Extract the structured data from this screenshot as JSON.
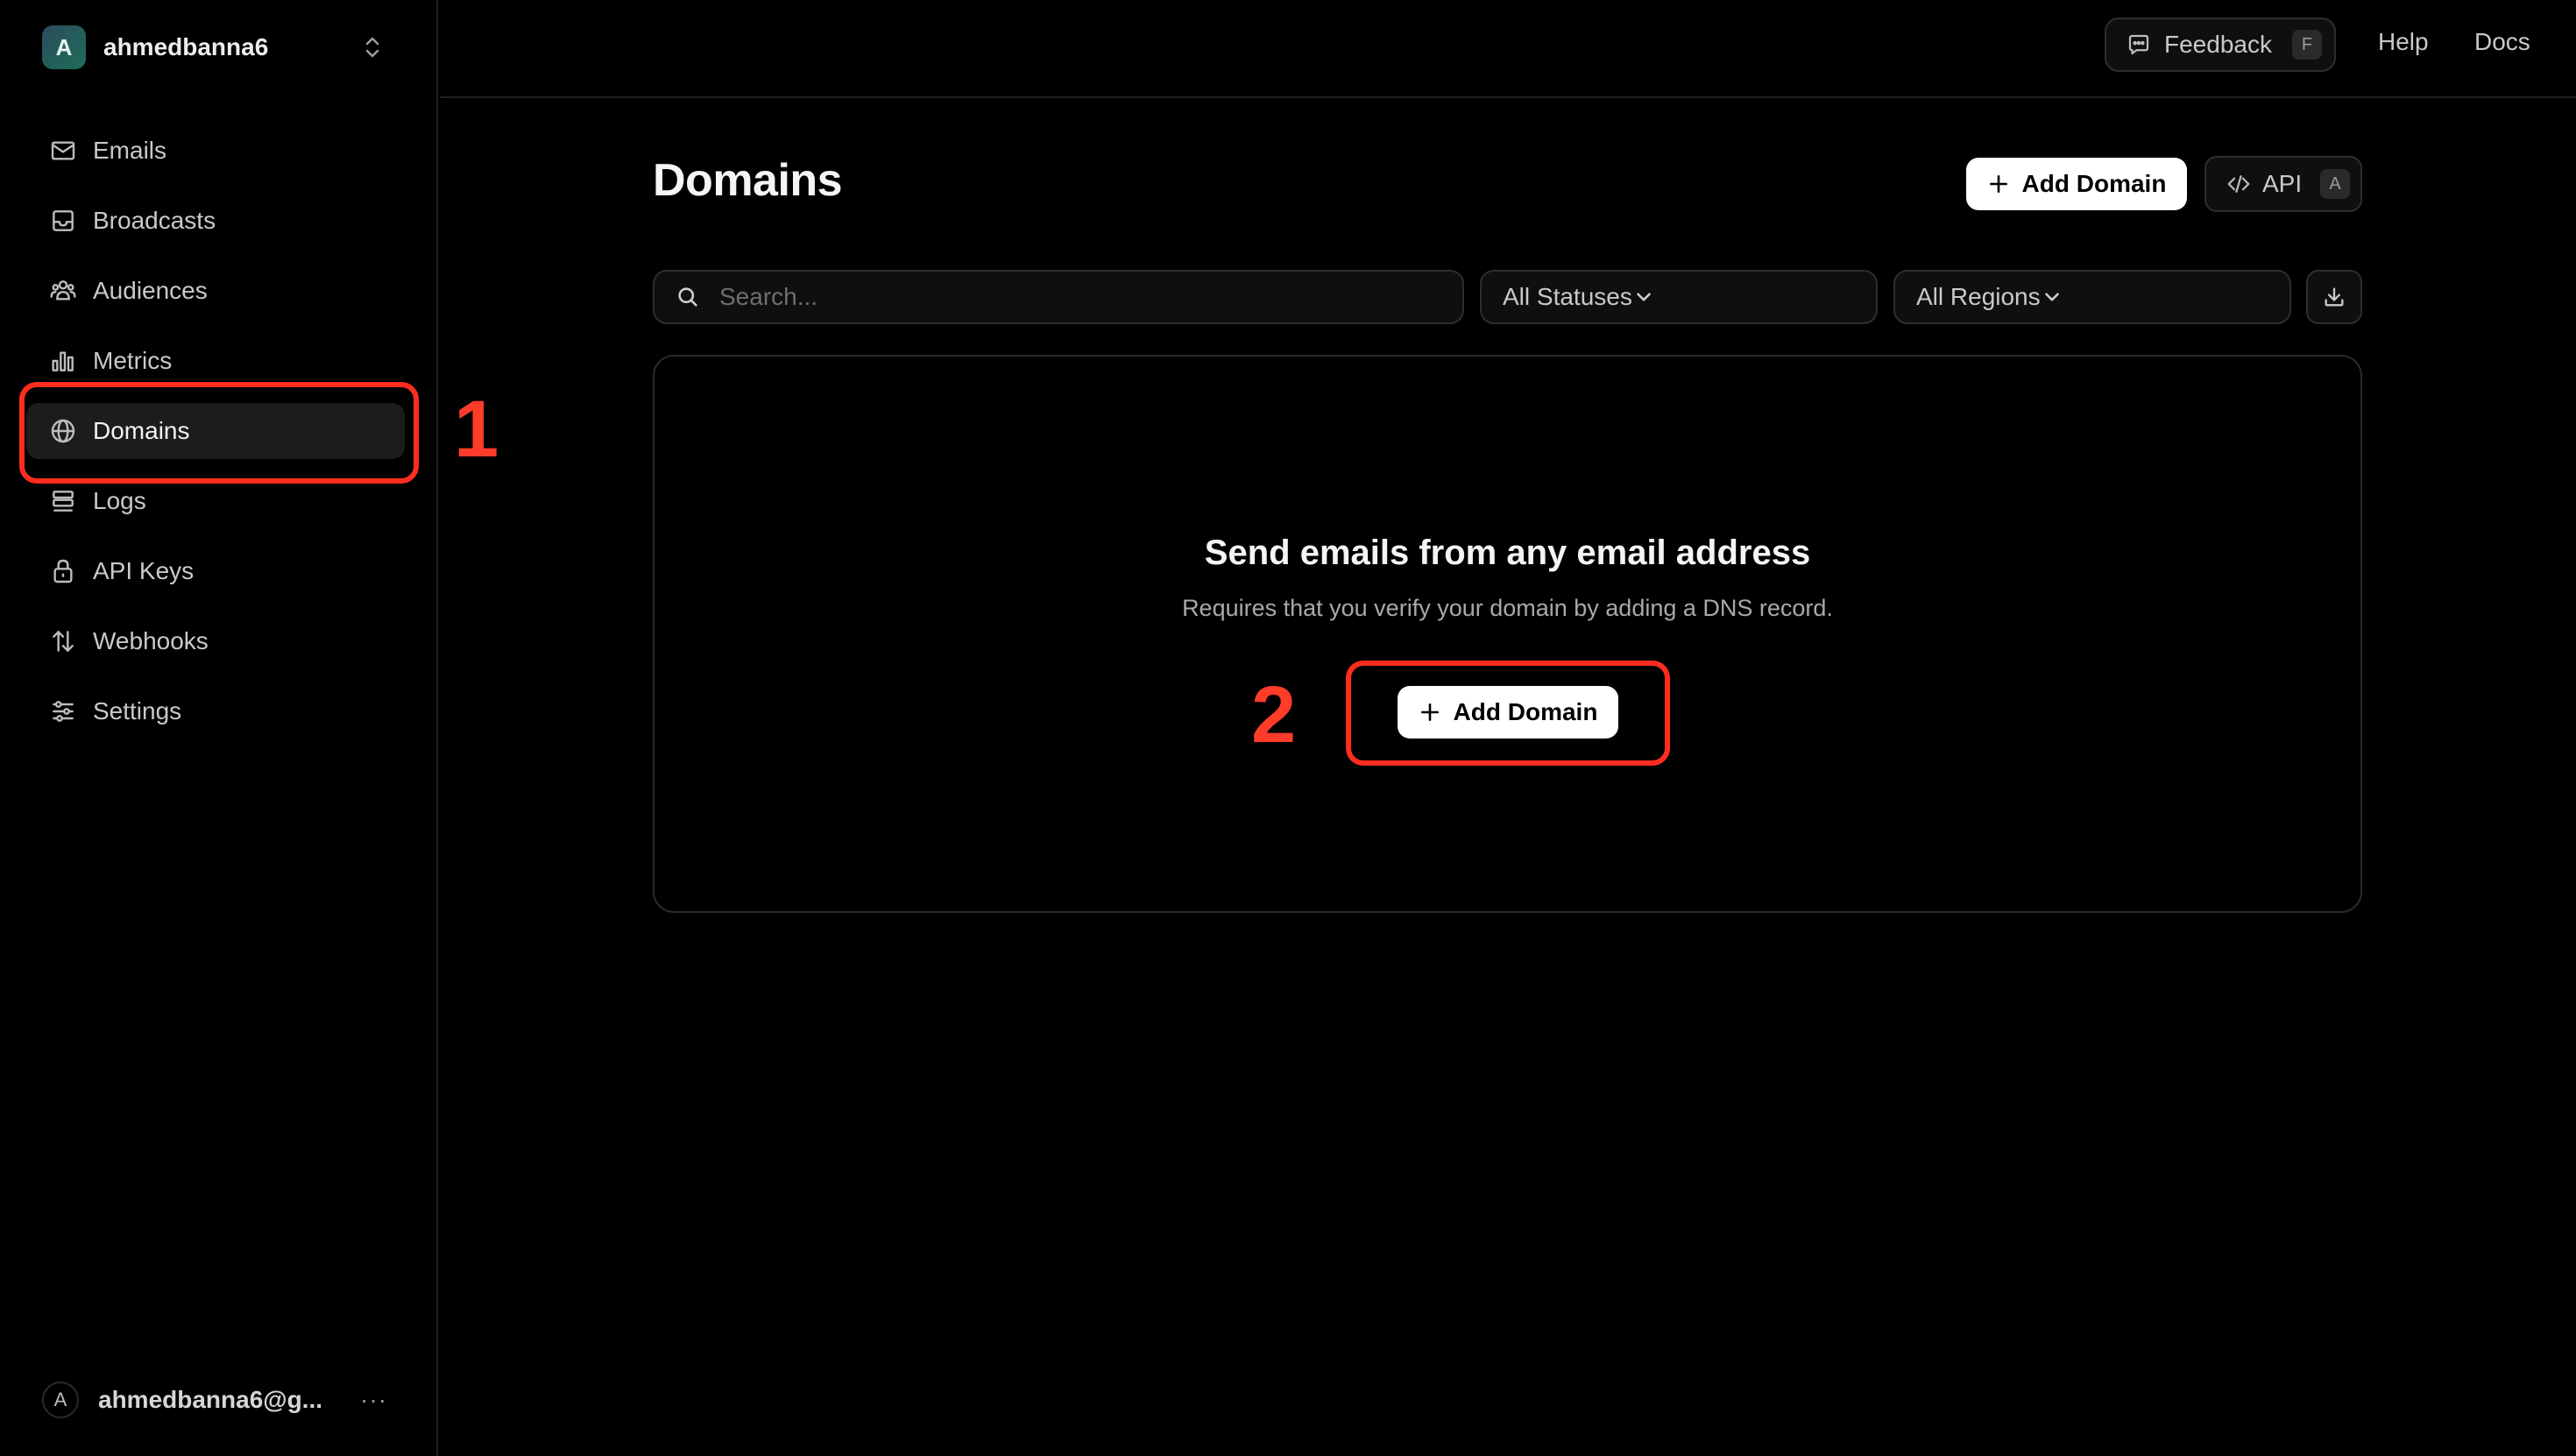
{
  "team": {
    "avatar_letter": "A",
    "name": "ahmedbanna6"
  },
  "sidebar": {
    "items": [
      {
        "label": "Emails",
        "icon": "mail-icon"
      },
      {
        "label": "Broadcasts",
        "icon": "inbox-icon"
      },
      {
        "label": "Audiences",
        "icon": "users-icon"
      },
      {
        "label": "Metrics",
        "icon": "bar-chart-icon"
      },
      {
        "label": "Domains",
        "icon": "globe-icon",
        "active": true
      },
      {
        "label": "Logs",
        "icon": "logs-icon"
      },
      {
        "label": "API Keys",
        "icon": "lock-icon"
      },
      {
        "label": "Webhooks",
        "icon": "arrows-up-down-icon"
      },
      {
        "label": "Settings",
        "icon": "sliders-icon"
      }
    ]
  },
  "user": {
    "avatar_letter": "A",
    "name": "ahmedbanna6@g...",
    "more": "···"
  },
  "topbar": {
    "feedback_label": "Feedback",
    "feedback_shortcut": "F",
    "help_label": "Help",
    "docs_label": "Docs"
  },
  "page": {
    "title": "Domains",
    "add_domain_label": "Add Domain",
    "api_label": "API",
    "api_shortcut": "A"
  },
  "filters": {
    "search_placeholder": "Search...",
    "status_value": "All Statuses",
    "region_value": "All Regions"
  },
  "empty_state": {
    "title": "Send emails from any email address",
    "subtitle": "Requires that you verify your domain by adding a DNS record.",
    "button_label": "Add Domain"
  },
  "annotations": {
    "step1": "1",
    "step2": "2",
    "highlight_color": "#ff2d1f"
  }
}
